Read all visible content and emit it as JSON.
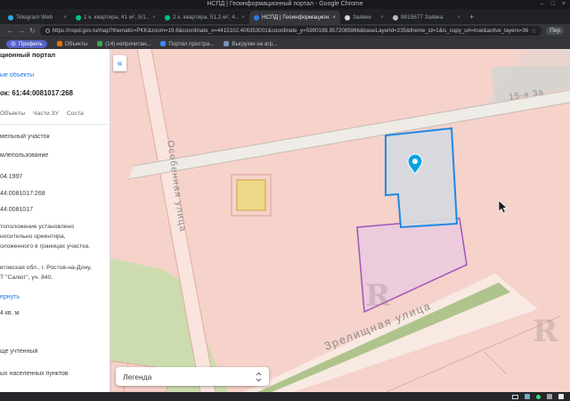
{
  "titlebar": {
    "title": "НСПД | Геоинформационный портал - Google Chrome",
    "minimize": "–",
    "maximize": "□",
    "close": "×"
  },
  "tabbar": {
    "new_tab_label": "+",
    "tabs": [
      {
        "label": "Telegram Web",
        "color": "#2aabee"
      },
      {
        "label": "1 к. квартира, 41 м², 5/1...",
        "color": "#00c389"
      },
      {
        "label": "2 к. квартира, 51.2 м², 4...",
        "color": "#00c389"
      },
      {
        "label": "НСПД | Геоинформацион...",
        "color": "#2b7de9"
      },
      {
        "label": "Заявки",
        "color": "#d8dadd"
      },
      {
        "label": "9815677 Заявка",
        "color": "#b9bdc1"
      }
    ]
  },
  "addressbar": {
    "back": "←",
    "forward": "→",
    "reload": "↻",
    "bookmark_star": "☆",
    "url": "https://nspd.gov.ru/map?thematic=PKK&zoom=19.6&coordinate_x=4415102.406353001&coordinate_y=5990198.9572085966&baseLayerId=235&theme_id=1&is_copy_url=true&active_layers=36048",
    "profile": "Пер"
  },
  "bookmarks": {
    "items": [
      {
        "label": "Профиль",
        "color": "#8f97e8"
      },
      {
        "label": "Объекты",
        "color": "#e8710a"
      },
      {
        "label": "(14) непрочитан...",
        "color": "#34a853"
      },
      {
        "label": "Портал простра...",
        "color": "#4285f4"
      },
      {
        "label": "Выгрузки на агр...",
        "color": "#7d93b2"
      }
    ]
  },
  "sidebar": {
    "header": "ционный портал",
    "favorites_link": "ые объекты",
    "object_title": "ок: 61:44:0081017:268",
    "tabs": [
      "Объекты",
      "Части ЗУ",
      "Соста"
    ],
    "values": {
      "type": "мельный участок",
      "usage": "млепользование",
      "date": "04.1997",
      "cad_number": "44:0081017:268",
      "quarter": "44:0081017",
      "desc1": "тоположение установлено",
      "desc2": "носительно ориентира,",
      "desc3": "оложенного в границах участка.",
      "addr1": "втовская обл., г. Ростов-на-Дону,",
      "addr2": "Т \"Салют\", уч. 840.",
      "expand_link": "ернуть",
      "area": "4 кв. м",
      "status": "ще учтенный",
      "land_category": "ых населенных пунктов"
    }
  },
  "map": {
    "collapse_glyph": "«",
    "legend_label": "Легенда",
    "watermark": "R",
    "streets": {
      "osobennaya": "Особенная улица",
      "zalineynaya": "15-я За",
      "zrelishchnaya": "Зрелищная улица"
    }
  }
}
